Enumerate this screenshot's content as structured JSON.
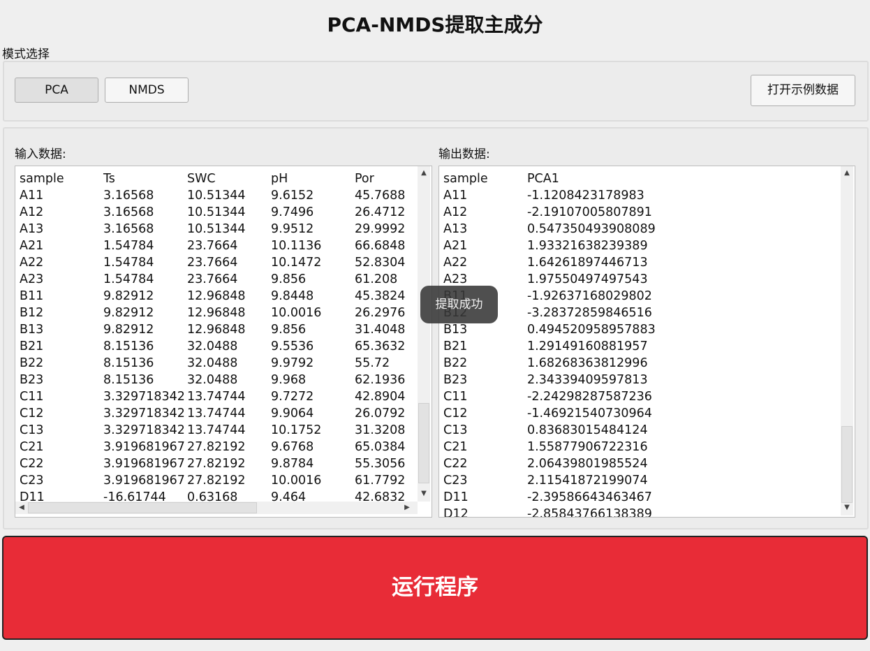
{
  "app": {
    "title": "PCA-NMDS提取主成分"
  },
  "mode": {
    "section_label": "模式选择",
    "buttons": [
      {
        "label": "PCA",
        "active": true
      },
      {
        "label": "NMDS",
        "active": false
      }
    ],
    "open_example_label": "打开示例数据"
  },
  "input": {
    "label": "输入数据:",
    "columns": [
      "sample",
      "Ts",
      "SWC",
      "pH",
      "Por"
    ],
    "rows": [
      [
        "A11",
        "3.16568",
        "10.51344",
        "9.6152",
        "45.7688"
      ],
      [
        "A12",
        "3.16568",
        "10.51344",
        "9.7496",
        "26.4712"
      ],
      [
        "A13",
        "3.16568",
        "10.51344",
        "9.9512",
        "29.9992"
      ],
      [
        "A21",
        "1.54784",
        "23.7664",
        "10.1136",
        "66.6848"
      ],
      [
        "A22",
        "1.54784",
        "23.7664",
        "10.1472",
        "52.8304"
      ],
      [
        "A23",
        "1.54784",
        "23.7664",
        "9.856",
        "61.208"
      ],
      [
        "B11",
        "9.82912",
        "12.96848",
        "9.8448",
        "45.3824"
      ],
      [
        "B12",
        "9.82912",
        "12.96848",
        "10.0016",
        "26.2976"
      ],
      [
        "B13",
        "9.82912",
        "12.96848",
        "9.856",
        "31.4048"
      ],
      [
        "B21",
        "8.15136",
        "32.0488",
        "9.5536",
        "65.3632"
      ],
      [
        "B22",
        "8.15136",
        "32.0488",
        "9.9792",
        "55.72"
      ],
      [
        "B23",
        "8.15136",
        "32.0488",
        "9.968",
        "62.1936"
      ],
      [
        "C11",
        "3.329718342",
        "13.74744",
        "9.7272",
        "42.8904"
      ],
      [
        "C12",
        "3.329718342",
        "13.74744",
        "9.9064",
        "26.0792"
      ],
      [
        "C13",
        "3.329718342",
        "13.74744",
        "10.1752",
        "31.3208"
      ],
      [
        "C21",
        "3.919681967",
        "27.82192",
        "9.6768",
        "65.0384"
      ],
      [
        "C22",
        "3.919681967",
        "27.82192",
        "9.8784",
        "55.3056"
      ],
      [
        "C23",
        "3.919681967",
        "27.82192",
        "10.0016",
        "61.7792"
      ],
      [
        "D11",
        "-16.61744",
        "0.63168",
        "9.464",
        "42.6832"
      ]
    ]
  },
  "output": {
    "label": "输出数据:",
    "columns": [
      "sample",
      "PCA1"
    ],
    "rows": [
      [
        "A11",
        "-1.1208423178983"
      ],
      [
        "A12",
        "-2.19107005807891"
      ],
      [
        "A13",
        "0.547350493908089"
      ],
      [
        "A21",
        "1.93321638239389"
      ],
      [
        "A22",
        "1.64261897446713"
      ],
      [
        "A23",
        "1.97550497497543"
      ],
      [
        "B11",
        "-1.92637168029802"
      ],
      [
        "B12",
        "-3.28372859846516"
      ],
      [
        "B13",
        "0.494520958957883"
      ],
      [
        "B21",
        "1.29149160881957"
      ],
      [
        "B22",
        "1.68268363812996"
      ],
      [
        "B23",
        "2.34339409597813"
      ],
      [
        "C11",
        "-2.24298287587236"
      ],
      [
        "C12",
        "-1.46921540730964"
      ],
      [
        "C13",
        "0.83683015484124"
      ],
      [
        "C21",
        "1.55877906722316"
      ],
      [
        "C22",
        "2.06439801985524"
      ],
      [
        "C23",
        "2.11541872199074"
      ],
      [
        "D11",
        "-2.39586643463467"
      ],
      [
        "D12",
        "-2.85843766138389"
      ]
    ]
  },
  "toast": {
    "message": "提取成功"
  },
  "run": {
    "label": "运行程序"
  },
  "colors": {
    "run_button": "#e82c37",
    "background": "#efefef"
  }
}
